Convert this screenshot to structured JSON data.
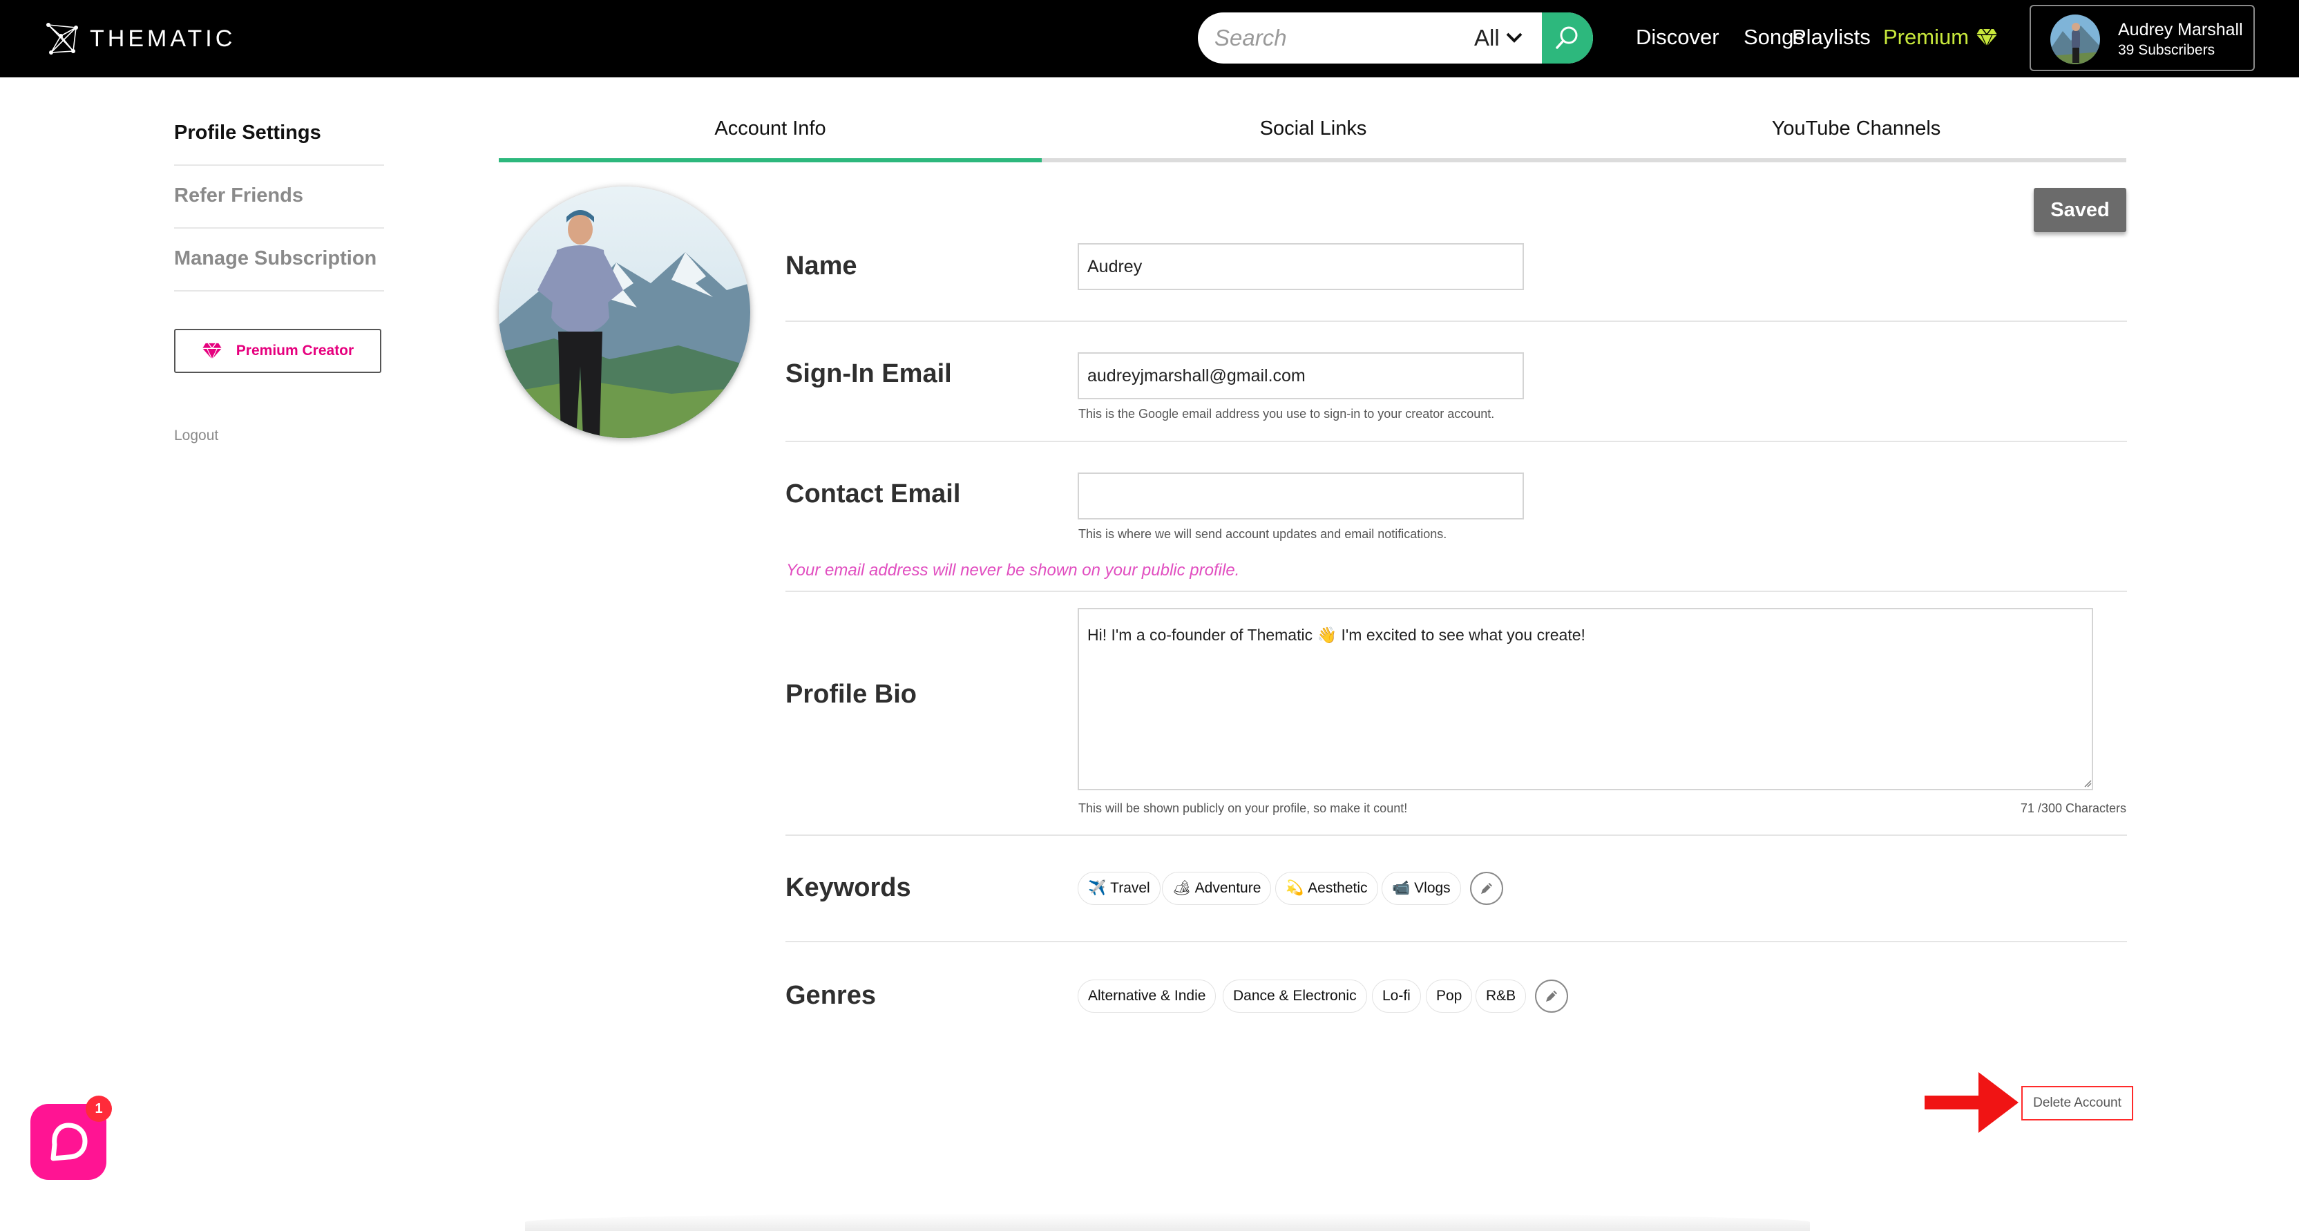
{
  "brand": {
    "name": "THEMATIC"
  },
  "search": {
    "placeholder": "Search",
    "scope": "All"
  },
  "nav": {
    "discover": "Discover",
    "songs": "Songs",
    "playlists": "Playlists",
    "premium": "Premium"
  },
  "user": {
    "name": "Audrey Marshall",
    "subscribers": "39 Subscribers"
  },
  "sidebar": {
    "items": [
      {
        "label": "Profile Settings",
        "active": true
      },
      {
        "label": "Refer Friends",
        "active": false
      },
      {
        "label": "Manage Subscription",
        "active": false
      }
    ],
    "premium_button": "Premium Creator",
    "logout": "Logout"
  },
  "tabs": [
    {
      "label": "Account Info",
      "active": true
    },
    {
      "label": "Social Links",
      "active": false
    },
    {
      "label": "YouTube Channels",
      "active": false
    }
  ],
  "saved_button": "Saved",
  "form": {
    "name": {
      "label": "Name",
      "value": "Audrey"
    },
    "signin_email": {
      "label": "Sign-In Email",
      "value": "audreyjmarshall@gmail.com",
      "hint": "This is the Google email address you use to sign-in to your creator account."
    },
    "contact_email": {
      "label": "Contact Email",
      "value": "",
      "hint": "This is where we will send account updates and email notifications."
    },
    "privacy_note": "Your email address will never be shown on your public profile.",
    "bio": {
      "label": "Profile Bio",
      "value": "Hi! I'm a co-founder of Thematic 👋 I'm excited to see what you create!",
      "hint": "This will be shown publicly on your profile, so make it count!",
      "count": "71 /300 Characters"
    },
    "keywords": {
      "label": "Keywords",
      "items": [
        {
          "icon": "✈️",
          "label": "Travel"
        },
        {
          "icon": "🏕",
          "label": "Adventure"
        },
        {
          "icon": "💫",
          "label": "Aesthetic"
        },
        {
          "icon": "📹",
          "label": "Vlogs"
        }
      ]
    },
    "genres": {
      "label": "Genres",
      "items": [
        "Alternative & Indie",
        "Dance & Electronic",
        "Lo-fi",
        "Pop",
        "R&B"
      ]
    }
  },
  "delete_account": "Delete Account",
  "chat": {
    "badge": "1"
  },
  "colors": {
    "accent": "#2db87d",
    "premium_pink": "#e6007e",
    "premium_green": "#c8e83c",
    "annotation_red": "#ff2a2a"
  }
}
